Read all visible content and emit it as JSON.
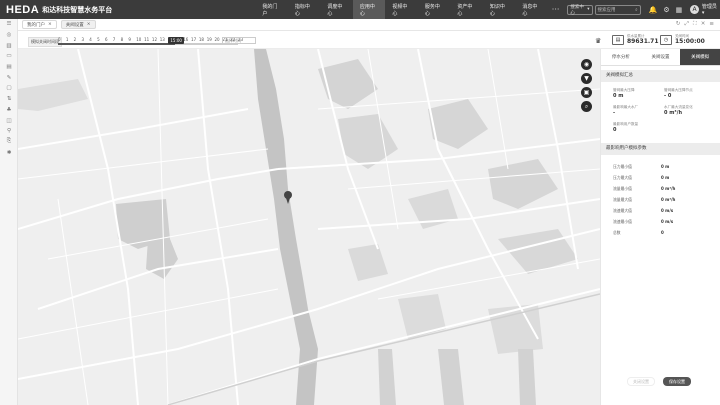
{
  "app": {
    "logo": "HEDA",
    "title": "和达科技智慧水务平台"
  },
  "nav": [
    "我的门户",
    "指标中心",
    "调度中心",
    "应用中心",
    "视频中心",
    "服务中心",
    "资产中心",
    "知识中心",
    "消息中心"
  ],
  "nav_active": 3,
  "more": "···",
  "top_dropdown": {
    "label": "搜索中心",
    "arrow": "▾"
  },
  "top_search": {
    "placeholder": "搜索应用"
  },
  "top_icons": [
    "bell-icon",
    "settings-icon",
    "grid-icon"
  ],
  "user": {
    "avatar": "A",
    "name": "管理员 ▾"
  },
  "tabs": [
    {
      "label": "我的门户",
      "close": "×"
    },
    {
      "label": "关阀设置",
      "close": "×"
    }
  ],
  "sidebar_icons": [
    "menu-icon",
    "target-icon",
    "chart-icon",
    "monitor-icon",
    "doc-icon",
    "edit-icon",
    "document-icon",
    "flow-icon",
    "tree-icon",
    "layers-icon",
    "pin-icon",
    "copy-icon",
    "star-icon"
  ],
  "timeline": {
    "label": "模拟关阀时间段",
    "ticks": [
      "0",
      "1",
      "2",
      "3",
      "4",
      "5",
      "6",
      "7",
      "8",
      "9",
      "10",
      "11",
      "12",
      "13",
      "14",
      "15",
      "16",
      "17",
      "18",
      "19",
      "20",
      "21",
      "22",
      "23"
    ],
    "selected": "15:00",
    "selected_value": 15,
    "range_end": 23,
    "time_placeholder": "选择时间"
  },
  "stats": [
    {
      "label": "供水量累计",
      "value": "89631.71"
    },
    {
      "label": "关阀时间",
      "value": "15:00:00"
    }
  ],
  "map_controls": [
    "eye-icon",
    "location-icon",
    "layers-icon",
    "search-icon"
  ],
  "panel": {
    "tabs": [
      "停水分析",
      "关阀设置",
      "关阀模拟"
    ],
    "active_tab": 2,
    "section1": {
      "title": "关阀模拟汇总",
      "items": [
        {
          "label": "管网最大压降",
          "value": "0 m"
        },
        {
          "label": "管网最大压降节点",
          "value": "- 0"
        },
        {
          "label": "最影响最大水厂",
          "value": "-"
        },
        {
          "label": "水厂最大流量变化",
          "value": "0 m³/h"
        },
        {
          "label": "最影响用户数量",
          "value": "0"
        }
      ]
    },
    "section2": {
      "title": "最影响用户模拟参数",
      "rows": [
        {
          "label": "压力最小值",
          "value": "0 m"
        },
        {
          "label": "压力最大值",
          "value": "0 m"
        },
        {
          "label": "流量最小值",
          "value": "0 m³/h"
        },
        {
          "label": "流量最大值",
          "value": "0 m³/h"
        },
        {
          "label": "流速最大值",
          "value": "0 m/s"
        },
        {
          "label": "流速最小值",
          "value": "0 m/s"
        },
        {
          "label": "总数",
          "value": "0"
        }
      ]
    },
    "buttons": {
      "reset": "关闭设置",
      "save": "保存设置"
    }
  },
  "colors": {
    "topbar": "#3b3b3b",
    "accent": "#444444",
    "map_bg": "#efefef",
    "water": "#c4c4c4"
  }
}
